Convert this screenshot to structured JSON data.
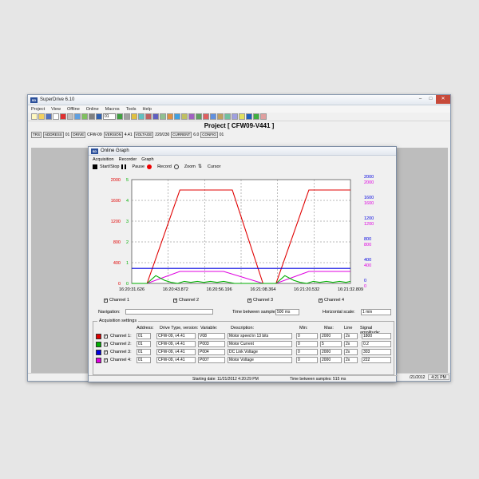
{
  "app": {
    "title": "SuperDrive 6.10",
    "icon_text": "SD",
    "menu": [
      "Project",
      "View",
      "Offline",
      "Online",
      "Macros",
      "Tools",
      "Help"
    ],
    "toolbar_select": "01",
    "project_title": "Project [ CFW09-V441 ]",
    "statusline": [
      {
        "label": "TRS",
        "value": ""
      },
      {
        "label": "ADDRESS",
        "value": "01"
      },
      {
        "label": "DRIVE",
        "value": "CFW-09"
      },
      {
        "label": "VERSION",
        "value": "4.41"
      },
      {
        "label": "VOLTAGE",
        "value": "220/230"
      },
      {
        "label": "CURRENT",
        "value": "6.0"
      },
      {
        "label": "CONFIG",
        "value": "01"
      }
    ],
    "status_date": "/21/2012",
    "status_time": "4:21 PM"
  },
  "graph": {
    "title": "Online Graph",
    "icon_text": "SD",
    "menu": [
      "Acquisition",
      "Recorder",
      "Graph"
    ],
    "toolbar": {
      "start_stop": "Start/Stop",
      "pause": "Pause",
      "record": "Record",
      "zoom": "Zoom",
      "cursor": "Cursor"
    },
    "navigation_label": "Navigation:",
    "time_between_label": "Time between samples:",
    "time_between_value": "500 ms",
    "horizontal_scale_label": "Horizontal scale:",
    "horizontal_scale_value": "1 min",
    "acq_title": "Acquisition settings",
    "acq_headers": {
      "address": "Address:",
      "drive_type": "Drive Type, version:",
      "variable": "Variable:",
      "description": "Description:",
      "min": "Min:",
      "max": "Max:",
      "line": "Line",
      "amplitude": "Signal amplitude:"
    },
    "channels": [
      {
        "name": "Channel 1:",
        "color": "#e00000",
        "address": "01",
        "drive": "CFW-09, v4.41",
        "variable": "V08",
        "description": "Motor speed in 13 bits",
        "min": "0",
        "max": "2000",
        "line": "2x",
        "amplitude": "1800"
      },
      {
        "name": "Channel 2:",
        "color": "#00b000",
        "address": "01",
        "drive": "CFW-09, v4.41",
        "variable": "P003",
        "description": "Motor Current",
        "min": "0",
        "max": "5",
        "line": "2x",
        "amplitude": "0.2"
      },
      {
        "name": "Channel 3:",
        "color": "#0000e0",
        "address": "01",
        "drive": "CFW-09, v4.41",
        "variable": "P004",
        "description": "DC Link Voltage",
        "min": "0",
        "max": "2000",
        "line": "2x",
        "amplitude": "303"
      },
      {
        "name": "Channel 4:",
        "color": "#e000e0",
        "address": "01",
        "drive": "CFW-09, v4.41",
        "variable": "P007",
        "description": "Motor Voltage",
        "min": "0",
        "max": "2000",
        "line": "2x",
        "amplitude": "222"
      }
    ],
    "channel_checks": [
      "Channel 1",
      "Channel 2",
      "Channel 3",
      "Channel 4"
    ],
    "status_start": "Starting date: 11/21/2012 4:20:29 PM",
    "status_tbs": "Time between samples: 515 ms"
  },
  "chart_data": {
    "type": "line",
    "x_ticks": [
      "16:20:31.626",
      "16:20:43.872",
      "16:20:56.196",
      "16:21:08.364",
      "16:21:20.532",
      "16:21:32.809"
    ],
    "left_axes": [
      {
        "color": "#e00000",
        "ticks": [
          "0",
          "400",
          "800",
          "1200",
          "1600",
          "2000"
        ]
      },
      {
        "color": "#00b000",
        "ticks": [
          "0",
          "1",
          "2",
          "3",
          "4",
          "5"
        ]
      }
    ],
    "right_axes": [
      {
        "color": "#0000e0",
        "ticks": [
          "0",
          "400",
          "800",
          "1200",
          "1600",
          "2000"
        ]
      },
      {
        "color": "#e000e0",
        "ticks": [
          "0",
          "400",
          "800",
          "1200",
          "1600",
          "2000"
        ]
      }
    ],
    "grid": true,
    "series": [
      {
        "color": "#e00000",
        "x": [
          0,
          0.07,
          0.22,
          0.42,
          0.46,
          0.6,
          0.66,
          0.81,
          1.0
        ],
        "y": [
          0,
          0,
          1800,
          1800,
          1800,
          0,
          0,
          1800,
          1800
        ]
      },
      {
        "color": "#0000e0",
        "x": [
          0,
          0.5,
          1.0
        ],
        "y": [
          290,
          290,
          290
        ]
      },
      {
        "color": "#e000e0",
        "x": [
          0,
          0.07,
          0.22,
          0.42,
          0.6,
          0.66,
          0.81,
          1.0
        ],
        "y": [
          0,
          0,
          230,
          230,
          0,
          0,
          230,
          230
        ]
      },
      {
        "color": "#00b000",
        "x": [
          0,
          0.07,
          0.11,
          0.15,
          0.18,
          0.21,
          0.24,
          0.27,
          0.3,
          0.33,
          0.36,
          0.39,
          0.42,
          0.47,
          0.55,
          0.6,
          0.66,
          0.7,
          0.74,
          0.77,
          0.8,
          0.83,
          0.86,
          0.89,
          0.92,
          0.95,
          0.98,
          1.0
        ],
        "y": [
          0,
          0,
          150,
          60,
          20,
          0,
          40,
          20,
          40,
          20,
          40,
          20,
          40,
          0,
          0,
          0,
          0,
          150,
          60,
          20,
          0,
          40,
          20,
          40,
          20,
          40,
          20,
          40
        ]
      }
    ]
  }
}
